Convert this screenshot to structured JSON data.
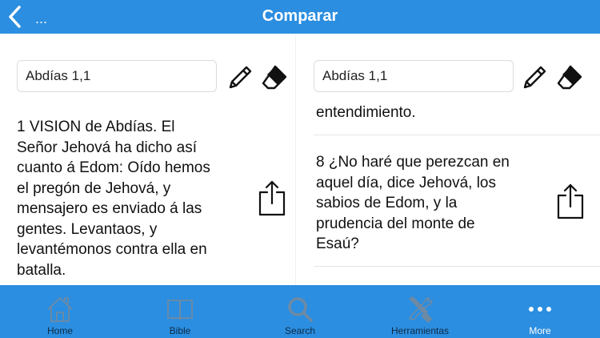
{
  "header": {
    "back_extra": "...",
    "title": "Comparar"
  },
  "left": {
    "reference": "Abdías 1,1",
    "verse": "1 VISION de Abdías. El\nSeñor Jehová ha dicho así\ncuanto á Edom: Oído hemos\nel pregón de Jehová, y\nmensajero es enviado á las\ngentes. Levantaos, y\nlevantémonos contra ella en\nbatalla."
  },
  "right": {
    "reference": "Abdías 1,1",
    "partial_verse": "entendimiento.",
    "verse": "8 ¿No haré que perezcan en\naquel día, dice Jehová, los\nsabios de Edom, y la\nprudencia del monte de\nEsaú?"
  },
  "tabbar": {
    "items": [
      {
        "label": "Home",
        "icon": "home-icon"
      },
      {
        "label": "Bible",
        "icon": "book-icon"
      },
      {
        "label": "Search",
        "icon": "search-icon"
      },
      {
        "label": "Herramientas",
        "icon": "tools-icon"
      },
      {
        "label": "More",
        "icon": "more-icon"
      }
    ]
  },
  "colors": {
    "accent": "#2b8ee0",
    "tab_inactive": "#0f2a44",
    "tab_icon": "#6f8aa3"
  }
}
